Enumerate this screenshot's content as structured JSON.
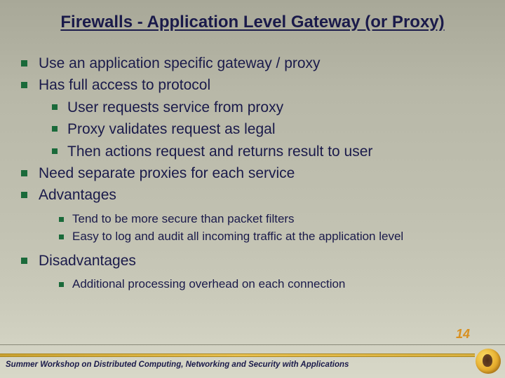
{
  "title": "Firewalls - Application Level Gateway (or Proxy)",
  "bullets": {
    "b1": "Use an application specific gateway / proxy",
    "b2": "Has full access to protocol",
    "b2a": "User requests service from proxy",
    "b2b": "Proxy validates request as legal",
    "b2c": "Then actions request and returns result to user",
    "b3": "Need separate proxies for each service",
    "b4": "Advantages",
    "b4a": "Tend to be more secure than packet filters",
    "b4b": "Easy to log and audit all incoming traffic at the application level",
    "b5": "Disadvantages",
    "b5a": "Additional processing overhead on each connection"
  },
  "footer": "Summer Workshop on Distributed Computing, Networking and Security with Applications",
  "page_number": "14"
}
